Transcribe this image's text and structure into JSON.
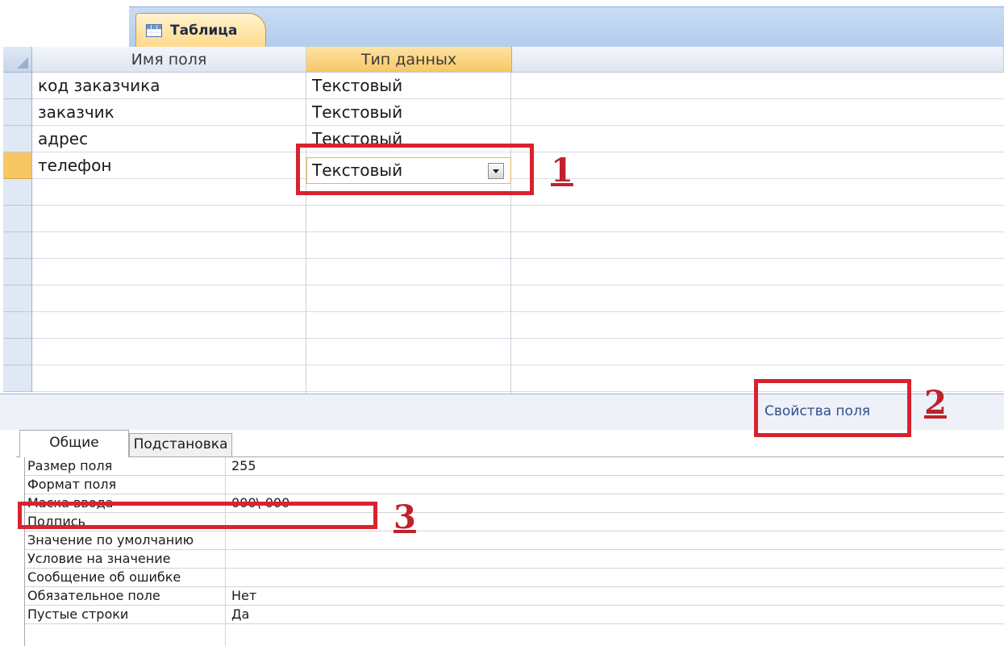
{
  "document_tab": {
    "label": "Таблица",
    "icon": "table-icon"
  },
  "grid": {
    "headers": {
      "field_name": "Имя поля",
      "data_type": "Тип данных"
    },
    "rows": [
      {
        "name": "код заказчика",
        "type": "Текстовый"
      },
      {
        "name": "заказчик",
        "type": "Текстовый"
      },
      {
        "name": "адрес",
        "type": "Текстовый"
      },
      {
        "name": "телефон",
        "type": "Текстовый"
      }
    ],
    "active_row": 3
  },
  "properties": {
    "title": "Свойства поля",
    "tabs": {
      "general": "Общие",
      "lookup": "Подстановка"
    },
    "rows": [
      {
        "label": "Размер поля",
        "value": "255"
      },
      {
        "label": "Формат поля",
        "value": ""
      },
      {
        "label": "Маска ввода",
        "value": "000\\-000"
      },
      {
        "label": "Подпись",
        "value": ""
      },
      {
        "label": "Значение по умолчанию",
        "value": ""
      },
      {
        "label": "Условие на значение",
        "value": ""
      },
      {
        "label": "Сообщение об ошибке",
        "value": ""
      },
      {
        "label": "Обязательное поле",
        "value": "Нет"
      },
      {
        "label": "Пустые строки",
        "value": "Да"
      }
    ]
  },
  "annotations": {
    "m1": "1",
    "m2": "2",
    "m3": "3"
  },
  "colors": {
    "annotation_red": "#d8232f",
    "active_header": "#f8c765",
    "tab_strip": "#b3cdee"
  }
}
